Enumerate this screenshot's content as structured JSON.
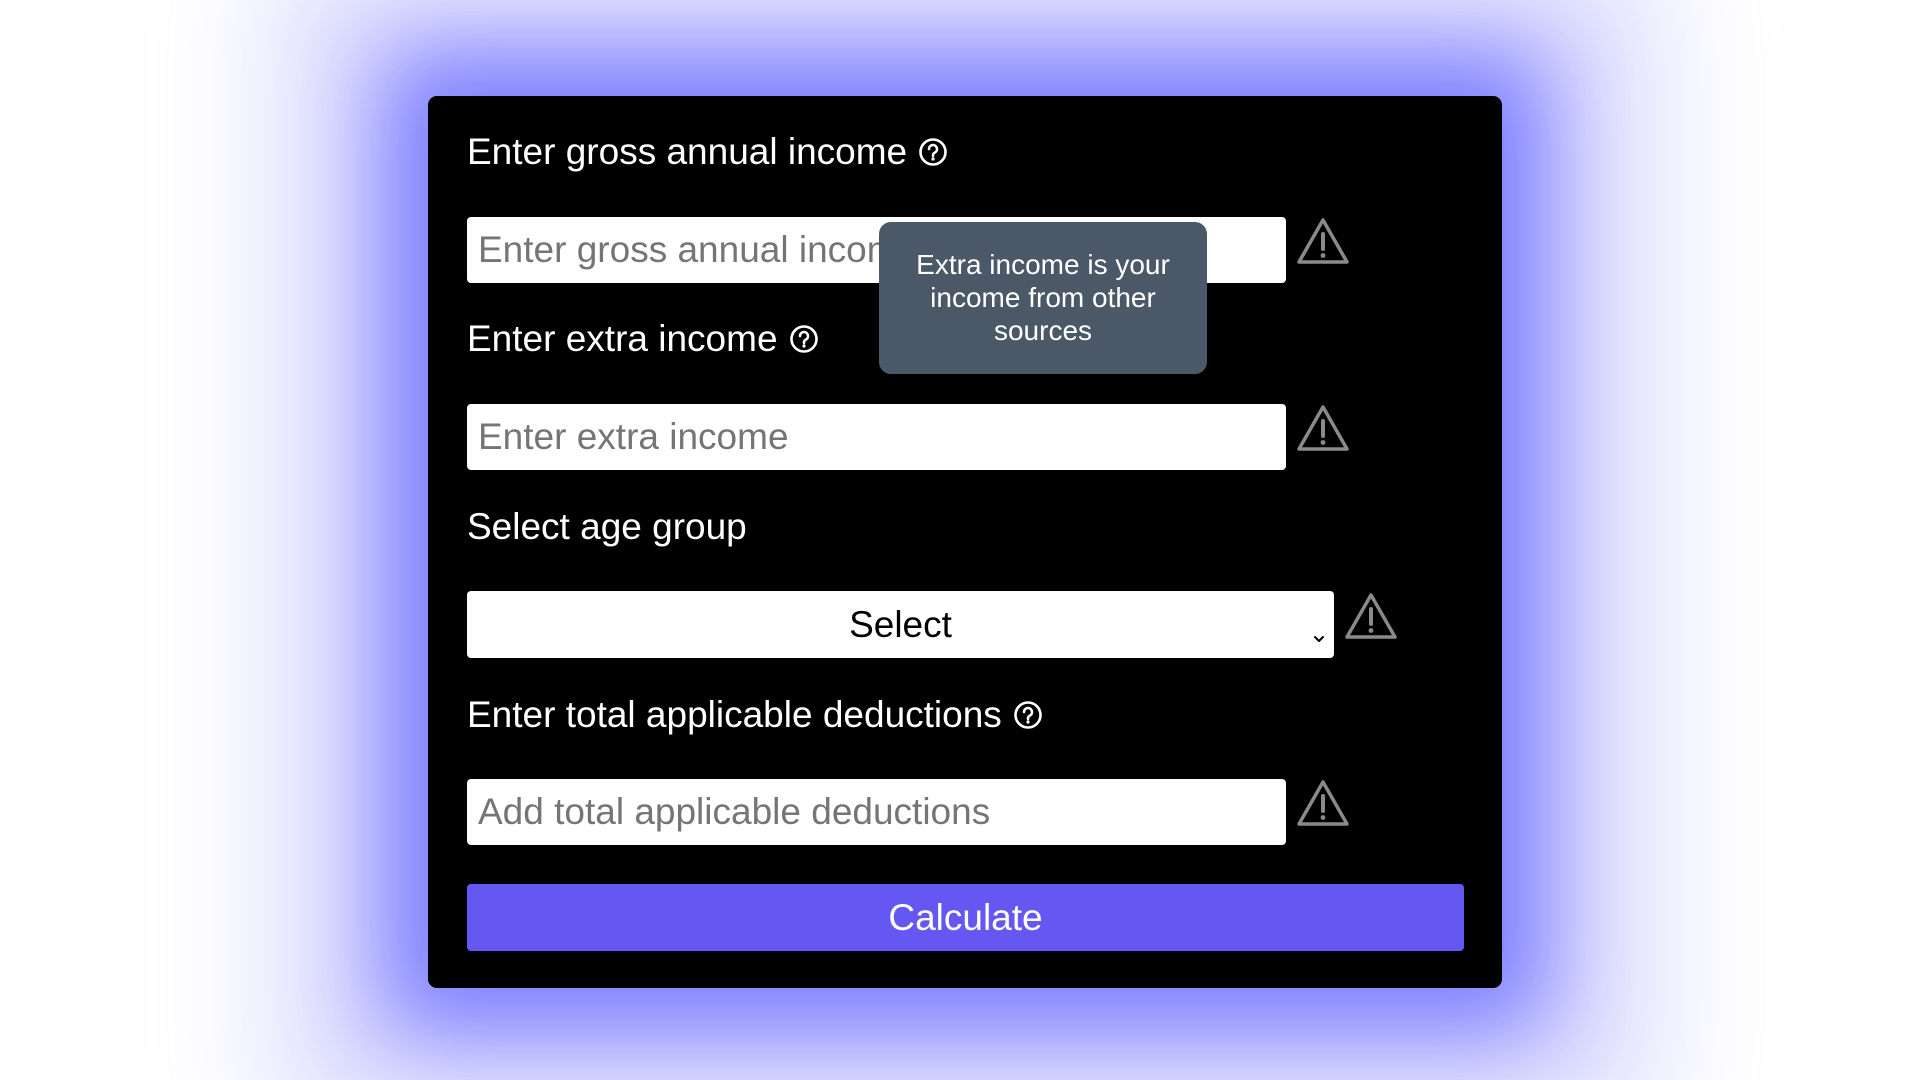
{
  "form": {
    "gross_income": {
      "label": "Enter gross annual income",
      "placeholder": "Enter gross annual income",
      "value": ""
    },
    "extra_income": {
      "label": "Enter extra income",
      "placeholder": "Enter extra income",
      "value": ""
    },
    "age_group": {
      "label": "Select age group",
      "selected": "Select"
    },
    "deductions": {
      "label": "Enter total applicable deductions",
      "placeholder": "Add total applicable deductions",
      "value": ""
    },
    "submit_label": "Calculate"
  },
  "tooltip": {
    "text": "Extra income is your income from other sources"
  },
  "icons": {
    "help": "help-circle-icon",
    "warning": "warning-triangle-icon",
    "chevron": "chevron-down-icon"
  },
  "colors": {
    "card_background": "#000000",
    "glow": "#7878ff",
    "button": "#6457f2",
    "tooltip_background": "#4a5867",
    "warning_icon": "#8a8a8a"
  }
}
